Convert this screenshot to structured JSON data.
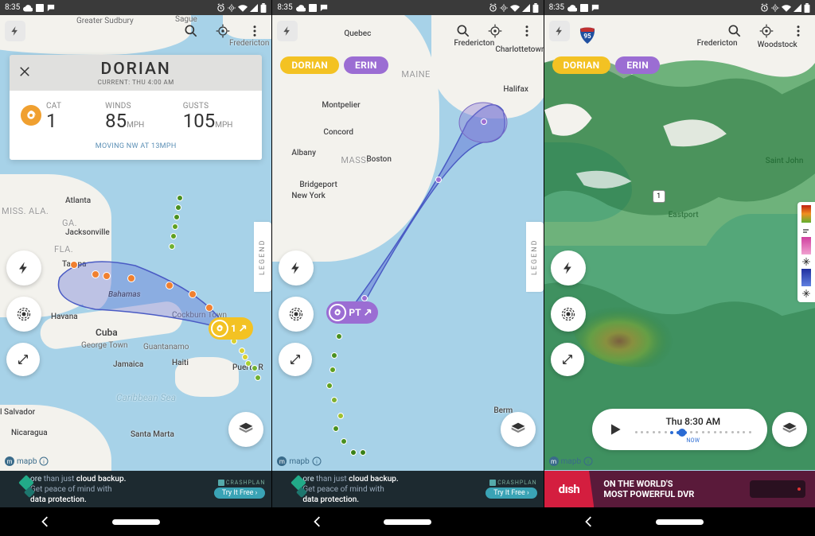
{
  "status_bar": {
    "time": "8:35"
  },
  "panel1": {
    "storm_card": {
      "title": "DORIAN",
      "subtitle": "CURRENT: THU 4:00 AM",
      "cat_label": "CAT",
      "cat_value": "1",
      "winds_label": "WINDS",
      "winds_value": "85",
      "winds_unit": "MPH",
      "gusts_label": "GUSTS",
      "gusts_value": "105",
      "gusts_unit": "MPH",
      "movement": "MOVING NW AT 13MPH"
    },
    "legend": "LEGEND",
    "storm_marker": {
      "num": "1"
    },
    "map_labels": {
      "greater_sudbury": "Greater\nSudbury",
      "saguenay": "Sague",
      "miss": "MISS.",
      "ala": "ALA.",
      "ga": "GA.",
      "fla": "FLA.",
      "atlanta": "Atlanta",
      "jacksonville": "Jacksonville",
      "tampa": "Tampa",
      "havana": "Havana",
      "cuba": "Cuba",
      "george_town": "George Town",
      "bahamas": "Bahamas",
      "cockburn": "Cockburn\nTown",
      "jamaica": "Jamaica",
      "haiti": "Haiti",
      "puerto_rico": "Puerto R",
      "guantanamo": "Guantanamo",
      "santa_marta": "Santa Marta",
      "salvador": "l Salvador",
      "nicaragua": "Nicaragua",
      "caribbean": "Caribbean Sea",
      "fredericton": "Fredericton"
    },
    "ad": {
      "line1_a": "ore ",
      "line1_b": "than just ",
      "line1_c": "cloud backup.",
      "line2_a": "Get peace of mind with",
      "line3_a": "data protection.",
      "brand": "CRASHPLAN",
      "cta": "Try It Free ›"
    }
  },
  "panel2": {
    "chips": {
      "dorian": "DORIAN",
      "erin": "ERIN"
    },
    "legend": "LEGEND",
    "storm_marker": {
      "label": "PT"
    },
    "map_labels": {
      "quebec": "Quebec",
      "fredericton": "Fredericton",
      "maine": "MAINE",
      "halifax": "Halifax",
      "montpelier": "Montpelier",
      "concord": "Concord",
      "albany": "Albany",
      "mass": "MASS.",
      "boston": "Boston",
      "bridgeport": "Bridgeport",
      "new_york": "New York",
      "bermuda": "Berm",
      "charlottetown": "Charlottetown"
    },
    "ad": {
      "line1_a": "ore ",
      "line1_b": "than just ",
      "line1_c": "cloud backup.",
      "line2_a": "Get peace of mind with",
      "line3_a": "data protection.",
      "brand": "CRASHPLAN",
      "cta": "Try It Free ›"
    }
  },
  "panel3": {
    "chips": {
      "dorian": "DORIAN",
      "erin": "ERIN"
    },
    "timeline": {
      "label": "Thu 8:30 AM",
      "now": "NOW"
    },
    "map_labels": {
      "fredericton": "Fredericton",
      "woodstock": "Woodstock",
      "saint_john": "Saint John",
      "eastport": "Eastport",
      "route": "1"
    },
    "ad": {
      "logo": "dısh",
      "line1": "ON THE WORLD'S",
      "line2": "MOST POWERFUL DVR"
    }
  },
  "attribution": "mapb"
}
